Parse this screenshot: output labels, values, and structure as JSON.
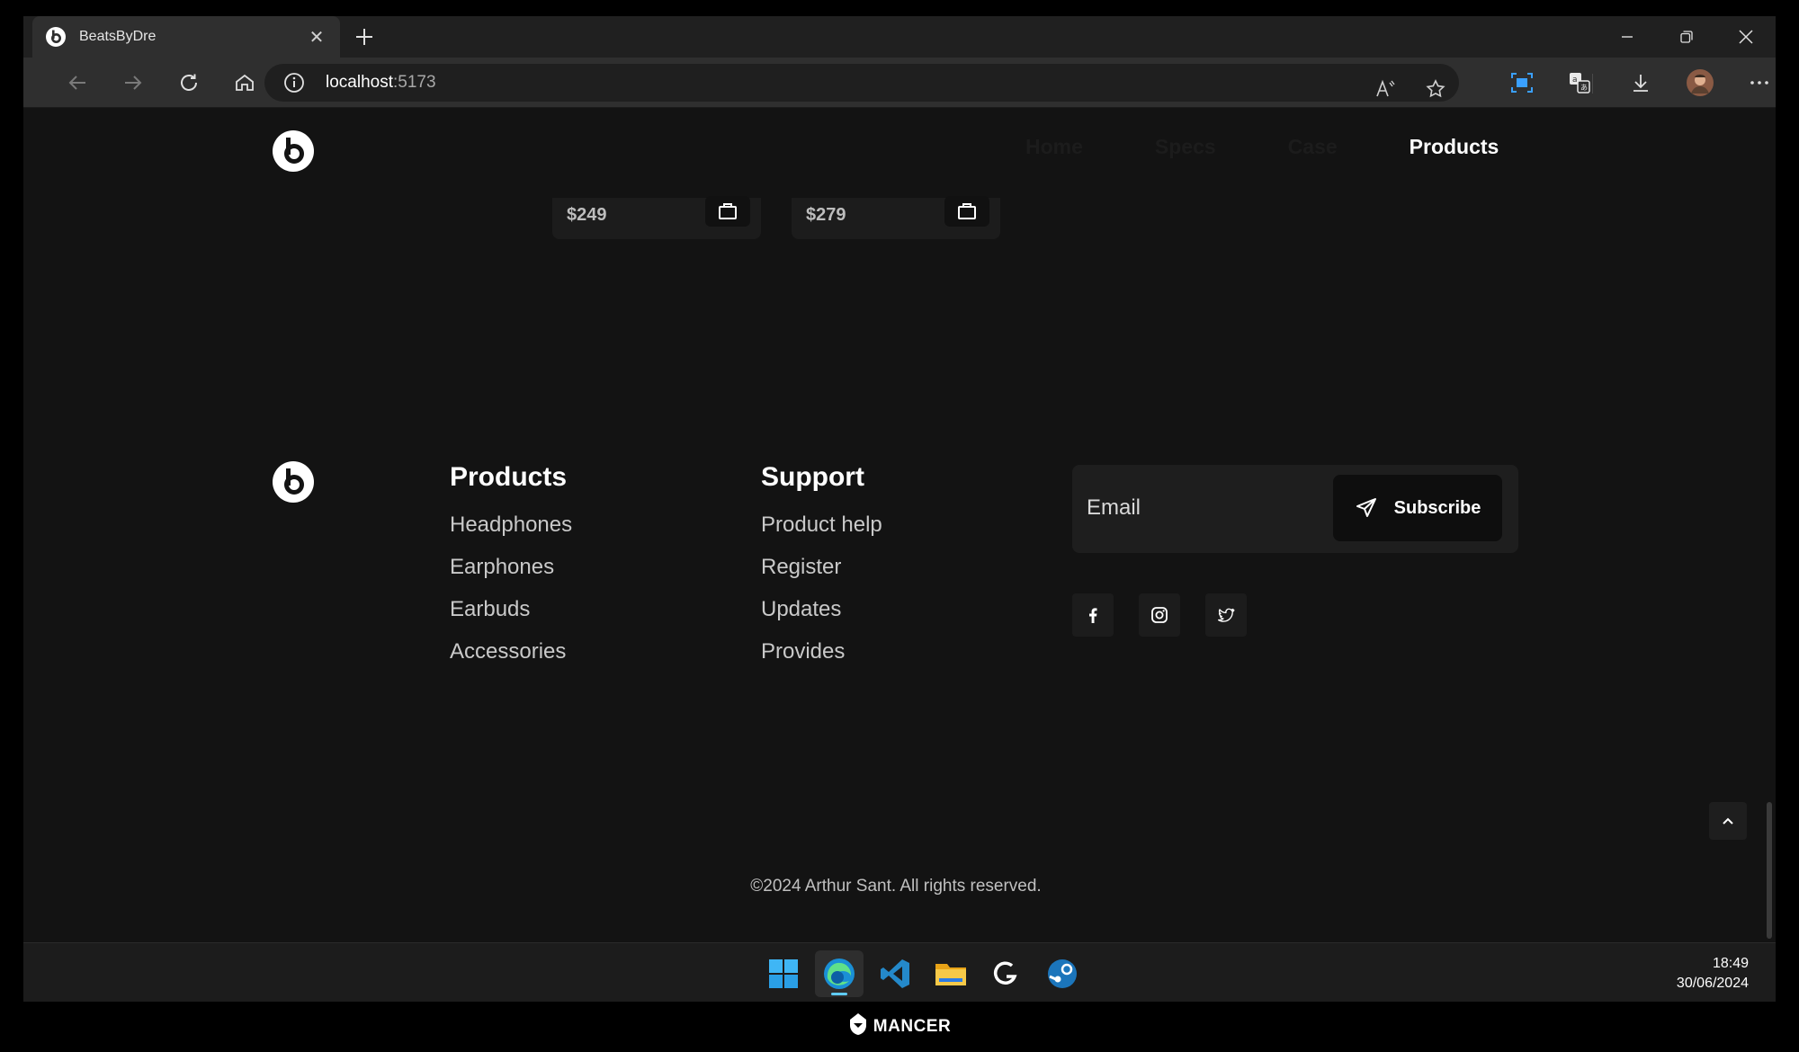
{
  "browser": {
    "tab_title": "BeatsByDre",
    "url_host": "localhost",
    "url_port": ":5173"
  },
  "nav": {
    "items": [
      "Home",
      "Specs",
      "Case",
      "Products"
    ],
    "active": "Products"
  },
  "products": [
    {
      "price": "$249"
    },
    {
      "price": "$279"
    }
  ],
  "footer": {
    "products": {
      "heading": "Products",
      "links": [
        "Headphones",
        "Earphones",
        "Earbuds",
        "Accessories"
      ]
    },
    "support": {
      "heading": "Support",
      "links": [
        "Product help",
        "Register",
        "Updates",
        "Provides"
      ]
    },
    "subscribe": {
      "placeholder": "Email",
      "button_label": "Subscribe"
    },
    "social": [
      "facebook-icon",
      "instagram-icon",
      "twitter-icon"
    ],
    "copyright": "©2024 Arthur Sant. All rights reserved."
  },
  "taskbar": {
    "apps": [
      "windows-start-icon",
      "edge-icon",
      "vscode-icon",
      "file-explorer-icon",
      "logitech-ghub-icon",
      "steam-icon"
    ],
    "time": "18:49",
    "date": "30/06/2024"
  },
  "brand": "MANCER",
  "colors": {
    "page_bg": "#131313",
    "accent_blue": "#60cdff"
  }
}
